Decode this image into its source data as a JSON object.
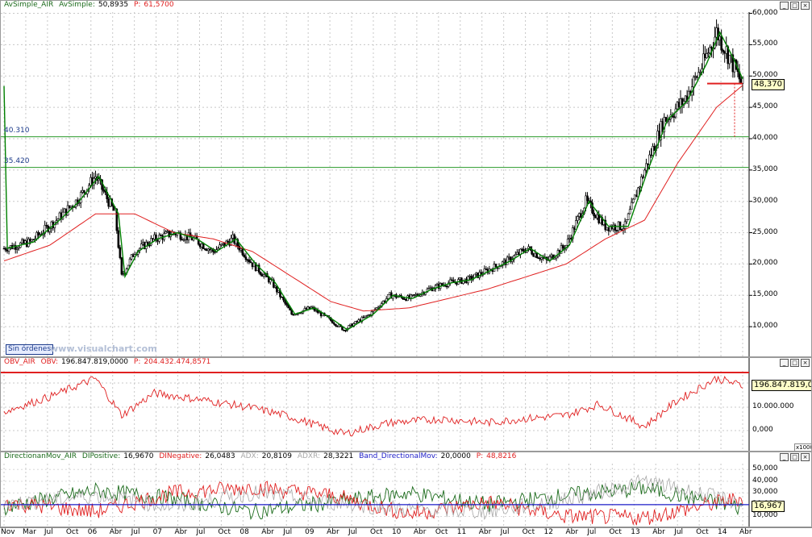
{
  "colors": {
    "price": "#000000",
    "sma_fast": "#008000",
    "sma_slow": "#e02020",
    "obv": "#e02020",
    "di_pos": "#1c6b1c",
    "di_neg": "#e02020",
    "adx": "#a8a8a8",
    "band": "#1c1cc8",
    "hline": "#2a9a2a",
    "cursor": "#e02020"
  },
  "panes": {
    "price": {
      "legend": {
        "name": "AvSimple_AIR",
        "label": "AvSimple:",
        "value": "50,8935",
        "p_label": "P:",
        "p_value": "61,5700"
      },
      "last_price": "48,370",
      "tag": "Sin órdenes",
      "watermark": "www.visualchart.com",
      "hlines": [
        "40.310",
        "35.420"
      ],
      "yticks": [
        "60,000",
        "55,000",
        "50,000",
        "45,000",
        "40,000",
        "35,000",
        "30,000",
        "25,000",
        "20,000",
        "15,000",
        "10,000"
      ]
    },
    "obv": {
      "legend": {
        "name": "OBV_AIR",
        "label": "OBV:",
        "value": "196.847.819,0000",
        "p_label": "P:",
        "p_value": "204.432.474,8571"
      },
      "last_value": "196.847.819,000",
      "yticks": [
        "10.000.000",
        "0,000"
      ],
      "multiplier": "x10000"
    },
    "dm": {
      "legend": {
        "name": "DirectionanMov_AIR",
        "dip_label": "DIPositive:",
        "dip_value": "16,9670",
        "din_label": "DINegative:",
        "din_value": "26,0483",
        "adx_label": "ADX:",
        "adx_value": "20,8109",
        "adxr_label": "ADXR:",
        "adxr_value": "28,3221",
        "band_label": "Band_DirectionalMov:",
        "band_value": "20,0000",
        "p_label": "P:",
        "p_value": "48,8216"
      },
      "last_value": "16,967",
      "yticks": [
        "50,000",
        "40,000",
        "30,000",
        "20,000",
        "10,000"
      ]
    }
  },
  "xaxis": [
    "Nov",
    "Mar",
    "Jul",
    "Oct",
    "06",
    "Abr",
    "Jul",
    "07",
    "Abr",
    "Jul",
    "Oct",
    "08",
    "Abr",
    "Jul",
    "09",
    "Abr",
    "Jul",
    "Oct",
    "10",
    "Abr",
    "Oct",
    "11",
    "Abr",
    "Jul",
    "Oct",
    "12",
    "Abr",
    "Jul",
    "Oct",
    "13",
    "Abr",
    "Jul",
    "Oct",
    "14",
    "Abr"
  ],
  "chart_data": [
    {
      "type": "line",
      "title": "AvSimple_AIR",
      "x_range": [
        "2004-11",
        "2014-04"
      ],
      "ylim": [
        5,
        60
      ],
      "series": [
        {
          "name": "AIR",
          "x": [
            "2004-11",
            "2005-03",
            "2005-07",
            "2005-10",
            "2006-01",
            "2006-04",
            "2006-05",
            "2006-07",
            "2006-10",
            "2007-01",
            "2007-04",
            "2007-07",
            "2007-10",
            "2008-01",
            "2008-04",
            "2008-07",
            "2008-10",
            "2009-01",
            "2009-03",
            "2009-07",
            "2009-10",
            "2010-01",
            "2010-04",
            "2010-07",
            "2010-10",
            "2011-01",
            "2011-04",
            "2011-07",
            "2011-10",
            "2012-01",
            "2012-04",
            "2012-07",
            "2012-10",
            "2013-01",
            "2013-04",
            "2013-07",
            "2013-10",
            "2013-12",
            "2014-02",
            "2014-04"
          ],
          "values": [
            22.5,
            23.5,
            27,
            30,
            34,
            28,
            18,
            22,
            24,
            25,
            24,
            22,
            24,
            20,
            17,
            12,
            13,
            11,
            9.5,
            12,
            15,
            14.5,
            16,
            17,
            17.5,
            19,
            20.5,
            22.5,
            20.5,
            23,
            30,
            26,
            26,
            35,
            43,
            46,
            52,
            57,
            53,
            48.4
          ]
        },
        {
          "name": "AvSimple",
          "x": [
            "2004-11",
            "2005-06",
            "2006-01",
            "2006-07",
            "2007-01",
            "2007-07",
            "2008-01",
            "2008-07",
            "2009-01",
            "2009-06",
            "2010-01",
            "2010-07",
            "2011-01",
            "2011-07",
            "2012-01",
            "2012-07",
            "2013-01",
            "2013-06",
            "2013-12",
            "2014-04"
          ],
          "values": [
            20.5,
            23,
            28,
            28,
            25,
            24,
            22,
            18,
            14,
            12.5,
            13,
            14.5,
            16,
            18,
            20,
            24,
            27,
            36,
            45,
            48.5
          ]
        }
      ],
      "hlines": [
        40.31,
        35.42
      ]
    },
    {
      "type": "line",
      "title": "OBV_AIR",
      "series": [
        {
          "name": "OBV",
          "x": [
            "2004-11",
            "2005-06",
            "2006-01",
            "2006-05",
            "2006-10",
            "2007-06",
            "2008-01",
            "2008-06",
            "2009-03",
            "2009-10",
            "2010-06",
            "2011-01",
            "2011-06",
            "2012-01",
            "2012-06",
            "2013-01",
            "2013-06",
            "2013-12",
            "2014-04"
          ],
          "values": [
            11,
            15,
            20,
            10,
            16,
            14,
            12,
            10,
            5,
            8,
            9,
            8,
            9,
            10,
            13,
            7,
            14,
            20,
            18
          ]
        }
      ]
    },
    {
      "type": "line",
      "title": "DirectionanMov_AIR",
      "ylim": [
        0,
        55
      ],
      "series": [
        {
          "name": "DIPositive",
          "x": [
            "2004-11",
            "2006-01",
            "2007-01",
            "2008-01",
            "2009-01",
            "2010-01",
            "2011-01",
            "2012-01",
            "2013-01",
            "2014-04"
          ],
          "values": [
            18,
            32,
            25,
            14,
            22,
            30,
            20,
            28,
            34,
            17
          ]
        },
        {
          "name": "DINegative",
          "x": [
            "2004-11",
            "2006-01",
            "2007-01",
            "2008-01",
            "2009-01",
            "2010-01",
            "2011-01",
            "2012-01",
            "2013-01",
            "2014-04"
          ],
          "values": [
            22,
            14,
            30,
            35,
            28,
            12,
            22,
            10,
            9,
            26
          ]
        },
        {
          "name": "ADX",
          "x": [
            "2004-11",
            "2006-01",
            "2007-01",
            "2008-01",
            "2009-01",
            "2010-01",
            "2011-01",
            "2012-01",
            "2013-01",
            "2014-04"
          ],
          "values": [
            20,
            28,
            18,
            30,
            22,
            16,
            14,
            24,
            40,
            21
          ]
        },
        {
          "name": "Band_DirectionalMov",
          "x": [
            "2004-11",
            "2014-04"
          ],
          "values": [
            20,
            20
          ]
        }
      ]
    }
  ]
}
